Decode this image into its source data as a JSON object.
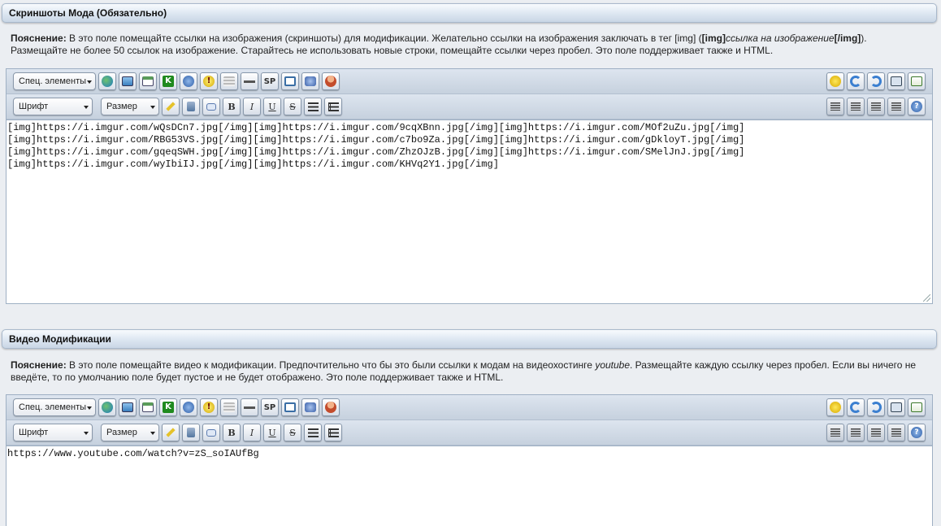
{
  "section1": {
    "header": "Скриншоты Мода (Обязательно)",
    "note_label": "Пояснение:",
    "note_text_a": " В это поле помещайте ссылки на изображения (скриншоты) для модификации. Желательно ссылки на изображения заключать в тег [img] (",
    "note_tag_open": "[img]",
    "note_italic": "ссылка на изображение",
    "note_tag_close": "[/img]",
    "note_text_b": ").",
    "note_text_c": "Размещайте не более 50 ссылок на изображение. Старайтесь не использовать новые строки, помещайте ссылки через пробел. Это поле поддерживает также и HTML.",
    "content": "[img]https://i.imgur.com/wQsDCn7.jpg[/img][img]https://i.imgur.com/9cqXBnn.jpg[/img][img]https://i.imgur.com/MOf2uZu.jpg[/img]\n[img]https://i.imgur.com/RBG53VS.jpg[/img][img]https://i.imgur.com/c7bo9Za.jpg[/img][img]https://i.imgur.com/gDkloyT.jpg[/img]\n[img]https://i.imgur.com/gqeqSWH.jpg[/img][img]https://i.imgur.com/ZhzOJzB.jpg[/img][img]https://i.imgur.com/SMelJnJ.jpg[/img]\n[img]https://i.imgur.com/wyIbiIJ.jpg[/img][img]https://i.imgur.com/KHVq2Y1.jpg[/img]"
  },
  "section2": {
    "header": "Видео Модификации",
    "note_label": "Пояснение:",
    "note_text_a": " В это поле помещайте видео к модификации. Предпочтительно что бы это были ссылки к модам на видеохостинге ",
    "note_italic": "youtube",
    "note_text_b": ". Размещайте каждую ссылку через пробел. Если вы ничего не введёте, то по умолчанию поле будет пустое и не будет отображено. Это поле поддерживает также и HTML.",
    "content": "https://www.youtube.com/watch?v=zS_soIAUfBg"
  },
  "toolbar": {
    "special_select": "Спец. элементы",
    "font_select": "Шрифт",
    "size_select": "Размер",
    "sp_label": "SP",
    "bold_label": "B",
    "italic_label": "I",
    "underline_label": "U",
    "strike_label": "S",
    "icons_row1_left": [
      "link-icon",
      "image-icon",
      "media-icon",
      "k-icon",
      "info-icon",
      "warning-icon",
      "hide-icon",
      "hr-icon",
      "sp-icon",
      "window-icon",
      "attachment-icon",
      "user-icon"
    ],
    "icons_row1_right": [
      "smiley-icon",
      "undo-icon",
      "redo-icon",
      "save-icon",
      "restore-icon"
    ],
    "icons_row2_right": [
      "align-left-icon",
      "align-center-icon",
      "align-right-icon",
      "align-justify-icon",
      "help-icon"
    ]
  }
}
